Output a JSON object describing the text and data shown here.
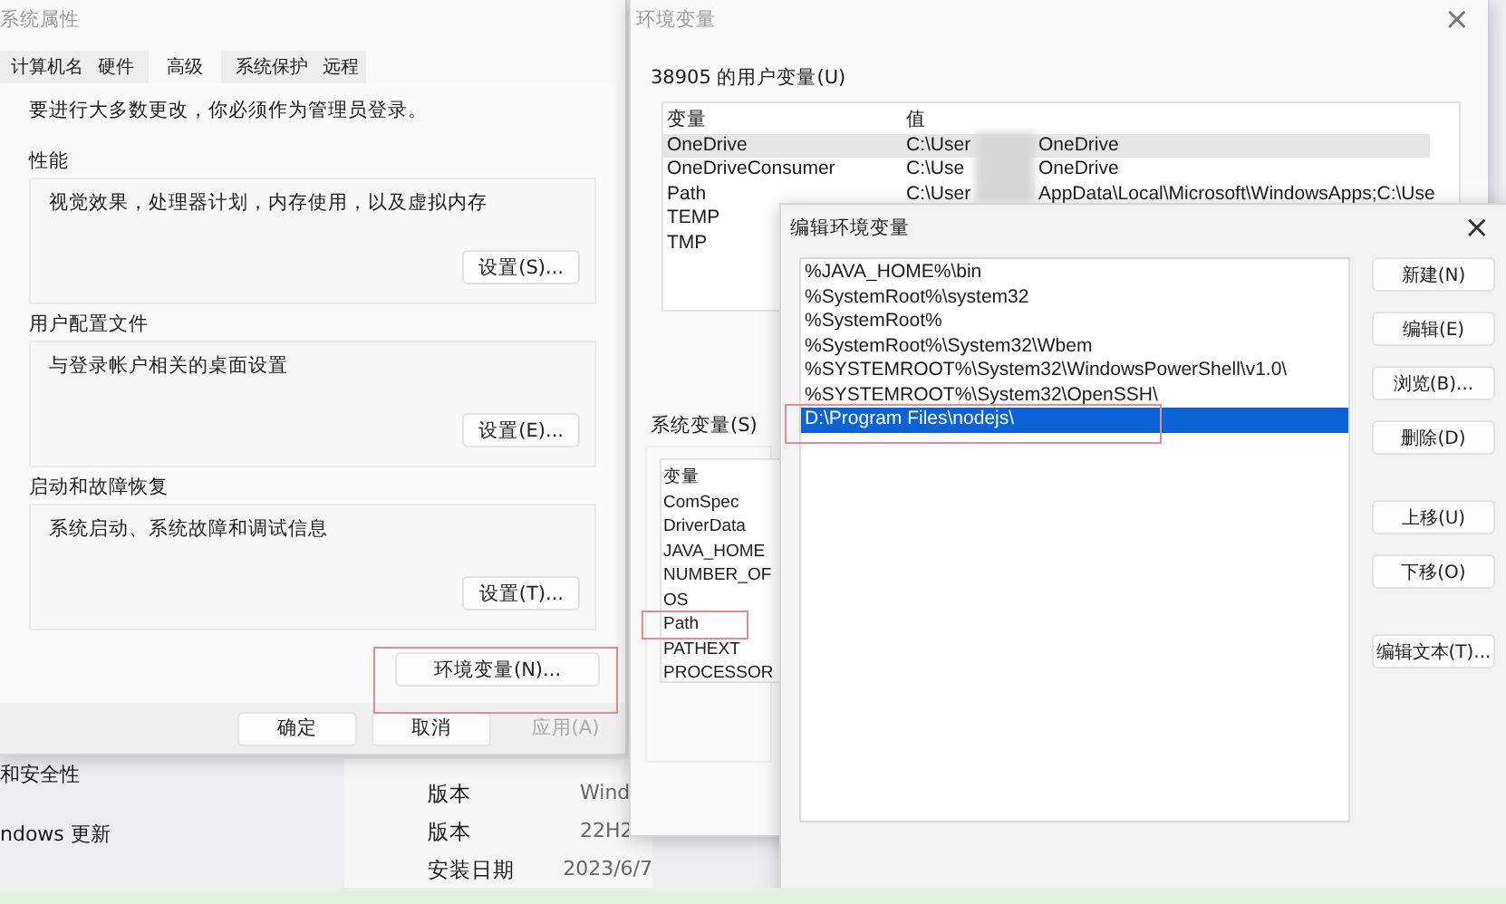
{
  "background_settings": {
    "nav_items": [
      "和安全性",
      "ndows 更新"
    ],
    "details": [
      {
        "label": "版本",
        "value": "Wind"
      },
      {
        "label": "版本",
        "value": "22H2"
      },
      {
        "label": "安装日期",
        "value": "2023/6/7"
      }
    ]
  },
  "system_properties": {
    "title": "系统属性",
    "tabs": [
      {
        "label": "计算机名",
        "selected": false
      },
      {
        "label": "硬件",
        "selected": false
      },
      {
        "label": "高级",
        "selected": true
      },
      {
        "label": "系统保护",
        "selected": false
      },
      {
        "label": "远程",
        "selected": false
      }
    ],
    "admin_note": "要进行大多数更改，你必须作为管理员登录。",
    "groups": [
      {
        "title": "性能",
        "description": "视觉效果，处理器计划，内存使用，以及虚拟内存",
        "button": "设置(S)..."
      },
      {
        "title": "用户配置文件",
        "description": "与登录帐户相关的桌面设置",
        "button": "设置(E)..."
      },
      {
        "title": "启动和故障恢复",
        "description": "系统启动、系统故障和调试信息",
        "button": "设置(T)..."
      }
    ],
    "env_button": {
      "label": "环境变量(N)...",
      "highlighted": true
    },
    "buttons": [
      {
        "label": "确定",
        "disabled": false
      },
      {
        "label": "取消",
        "disabled": false
      },
      {
        "label": "应用(A)",
        "disabled": true
      }
    ]
  },
  "environment_variables": {
    "title": "环境变量",
    "close": "×",
    "user_section": {
      "title": "38905 的用户变量(U)",
      "columns": [
        "变量",
        "值"
      ],
      "rows": [
        {
          "name": "OneDrive",
          "value_start": "C:\\User",
          "value_end": "OneDrive",
          "selected": true
        },
        {
          "name": "OneDriveConsumer",
          "value_start": "C:\\Use",
          "value_end": "OneDrive",
          "selected": false
        },
        {
          "name": "Path",
          "value_start": "C:\\User",
          "value_end": "AppData\\Local\\Microsoft\\WindowsApps;C:\\Use",
          "selected": false
        },
        {
          "name": "TEMP",
          "selected": false
        },
        {
          "name": "TMP",
          "selected": false
        }
      ]
    },
    "system_section": {
      "title": "系统变量(S)",
      "columns": [
        "变量"
      ],
      "rows": [
        {
          "name": "ComSpec",
          "selected": false,
          "highlighted": false
        },
        {
          "name": "DriverData",
          "selected": false,
          "highlighted": false
        },
        {
          "name": "JAVA_HOME",
          "selected": false,
          "highlighted": false
        },
        {
          "name": "NUMBER_OF",
          "selected": false,
          "highlighted": false
        },
        {
          "name": "OS",
          "selected": false,
          "highlighted": false
        },
        {
          "name": "Path",
          "selected": false,
          "highlighted": true
        },
        {
          "name": "PATHEXT",
          "selected": false,
          "highlighted": false
        },
        {
          "name": "PROCESSOR",
          "selected": false,
          "highlighted": false
        }
      ]
    }
  },
  "edit_dialog": {
    "title": "编辑环境变量",
    "close": "×",
    "entries": [
      {
        "text": "%JAVA_HOME%\\bin",
        "selected": false,
        "highlighted": false
      },
      {
        "text": "%SystemRoot%\\system32",
        "selected": false,
        "highlighted": false
      },
      {
        "text": "%SystemRoot%",
        "selected": false,
        "highlighted": false
      },
      {
        "text": "%SystemRoot%\\System32\\Wbem",
        "selected": false,
        "highlighted": false
      },
      {
        "text": "%SYSTEMROOT%\\System32\\WindowsPowerShell\\v1.0\\",
        "selected": false,
        "highlighted": false
      },
      {
        "text": "%SYSTEMROOT%\\System32\\OpenSSH\\",
        "selected": false,
        "highlighted": false
      },
      {
        "text": "D:\\Program Files\\nodejs\\",
        "selected": true,
        "highlighted": true
      }
    ],
    "button_groups": [
      [
        "新建(N)",
        "编辑(E)",
        "浏览(B)...",
        "删除(D)"
      ],
      [
        "上移(U)",
        "下移(O)"
      ],
      [
        "编辑文本(T)..."
      ]
    ]
  }
}
